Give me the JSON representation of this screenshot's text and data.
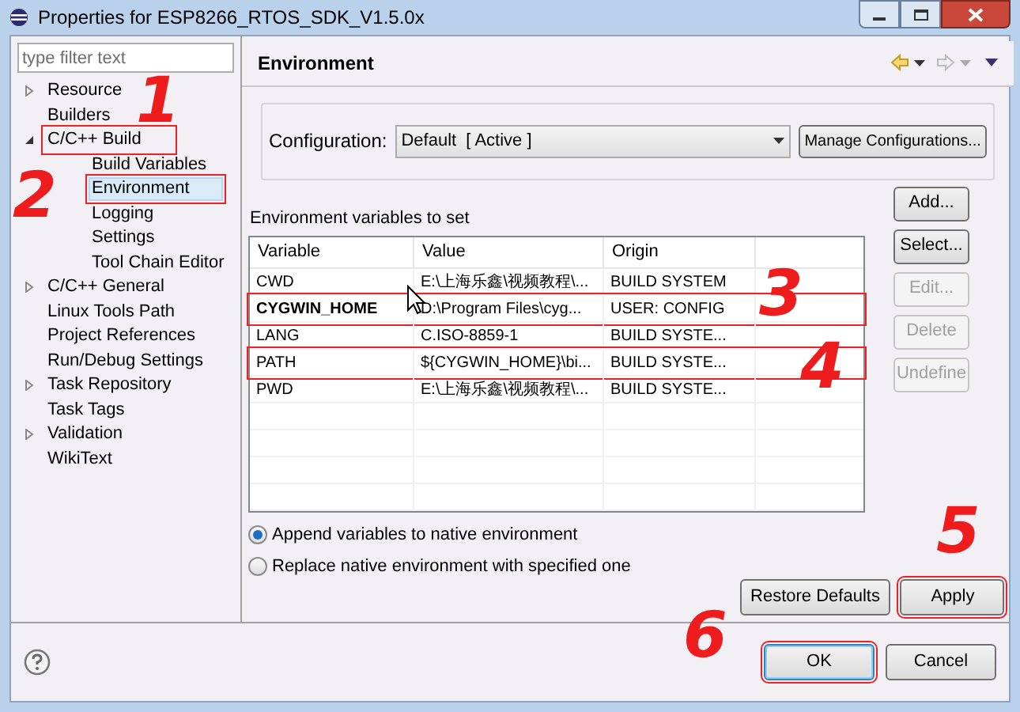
{
  "window": {
    "title": "Properties for ESP8266_RTOS_SDK_V1.5.0x"
  },
  "filter": {
    "placeholder": "type filter text"
  },
  "tree": [
    {
      "label": "Resource",
      "expanded": false,
      "selected": false,
      "annotated": false
    },
    {
      "label": "Builders",
      "selected": false,
      "annotated": false
    },
    {
      "label": "C/C++ Build",
      "expanded": true,
      "selected": false,
      "annotated": true,
      "children": [
        {
          "label": "Build Variables",
          "selected": false,
          "annotated": false
        },
        {
          "label": "Environment",
          "selected": true,
          "annotated": true
        },
        {
          "label": "Logging",
          "selected": false,
          "annotated": false
        },
        {
          "label": "Settings",
          "selected": false,
          "annotated": false
        },
        {
          "label": "Tool Chain Editor",
          "selected": false,
          "annotated": false
        }
      ]
    },
    {
      "label": "C/C++ General",
      "expanded": false,
      "selected": false,
      "annotated": false
    },
    {
      "label": "Linux Tools Path",
      "selected": false,
      "annotated": false
    },
    {
      "label": "Project References",
      "selected": false,
      "annotated": false
    },
    {
      "label": "Run/Debug Settings",
      "selected": false,
      "annotated": false
    },
    {
      "label": "Task Repository",
      "expanded": false,
      "selected": false,
      "annotated": false
    },
    {
      "label": "Task Tags",
      "selected": false,
      "annotated": false
    },
    {
      "label": "Validation",
      "expanded": false,
      "selected": false,
      "annotated": false
    },
    {
      "label": "WikiText",
      "selected": false,
      "annotated": false
    }
  ],
  "page": {
    "title": "Environment"
  },
  "configuration": {
    "label": "Configuration:",
    "value": "Default  [ Active ]",
    "button": "Manage Configurations..."
  },
  "table": {
    "caption": "Environment variables to set",
    "columns": [
      "Variable",
      "Value",
      "Origin"
    ],
    "rows": [
      {
        "cells": [
          "CWD",
          "E:\\上海乐鑫\\视频教程\\...",
          "BUILD SYSTEM"
        ],
        "bold": false,
        "annotated": false
      },
      {
        "cells": [
          "CYGWIN_HOME",
          "D:\\Program Files\\cyg...",
          "USER: CONFIG"
        ],
        "bold": true,
        "annotated": true
      },
      {
        "cells": [
          "LANG",
          "C.ISO-8859-1",
          "BUILD SYSTE..."
        ],
        "bold": false,
        "annotated": false
      },
      {
        "cells": [
          "PATH",
          "${CYGWIN_HOME}\\bi...",
          "BUILD SYSTE..."
        ],
        "bold": false,
        "annotated": true
      },
      {
        "cells": [
          "PWD",
          "E:\\上海乐鑫\\视频教程\\...",
          "BUILD SYSTE..."
        ],
        "bold": false,
        "annotated": false
      }
    ]
  },
  "side_buttons": [
    {
      "label": "Add...",
      "disabled": false
    },
    {
      "label": "Select...",
      "disabled": false
    },
    {
      "label": "Edit...",
      "disabled": true
    },
    {
      "label": "Delete",
      "disabled": true
    },
    {
      "label": "Undefine",
      "disabled": true
    }
  ],
  "radios": [
    {
      "label": "Append variables to native environment",
      "selected": true
    },
    {
      "label": "Replace native environment with specified one",
      "selected": false
    }
  ],
  "page_buttons": [
    {
      "label": "Restore Defaults",
      "annotated": false
    },
    {
      "label": "Apply",
      "annotated": true
    }
  ],
  "dialog_buttons": [
    {
      "label": "OK",
      "default": true,
      "annotated": true
    },
    {
      "label": "Cancel",
      "default": false,
      "annotated": false
    }
  ],
  "annotations": [
    "1",
    "2",
    "3",
    "4",
    "5",
    "6"
  ]
}
